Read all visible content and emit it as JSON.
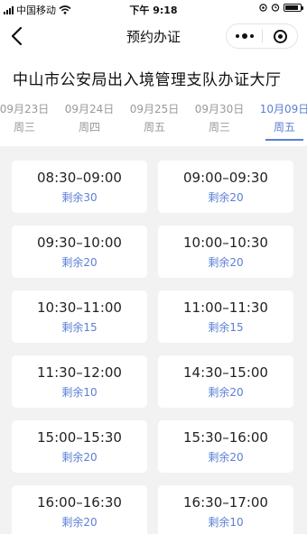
{
  "status": {
    "carrier": "中国移动",
    "time": "下午 9:18",
    "battery_level": 0.85
  },
  "nav": {
    "title": "预约办证"
  },
  "office": {
    "title": "中山市公安局出入境管理支队办证大厅"
  },
  "dates": [
    {
      "date": "09月23日",
      "weekday": "周三"
    },
    {
      "date": "09月24日",
      "weekday": "周四"
    },
    {
      "date": "09月25日",
      "weekday": "周五"
    },
    {
      "date": "09月30日",
      "weekday": "周三"
    },
    {
      "date": "10月09日",
      "weekday": "周五",
      "active": true
    }
  ],
  "slots": [
    {
      "time": "08:30–09:00",
      "remain": "剩余30"
    },
    {
      "time": "09:00–09:30",
      "remain": "剩余20"
    },
    {
      "time": "09:30–10:00",
      "remain": "剩余20"
    },
    {
      "time": "10:00–10:30",
      "remain": "剩余20"
    },
    {
      "time": "10:30–11:00",
      "remain": "剩余15"
    },
    {
      "time": "11:00–11:30",
      "remain": "剩余15"
    },
    {
      "time": "11:30–12:00",
      "remain": "剩余10"
    },
    {
      "time": "14:30–15:00",
      "remain": "剩余20"
    },
    {
      "time": "15:00–15:30",
      "remain": "剩余20"
    },
    {
      "time": "15:30–16:00",
      "remain": "剩余20"
    },
    {
      "time": "16:00–16:30",
      "remain": "剩余20"
    },
    {
      "time": "16:30–17:00",
      "remain": "剩余10"
    }
  ],
  "colors": {
    "accent": "#5b7fd6",
    "background": "#f2f2f2"
  }
}
